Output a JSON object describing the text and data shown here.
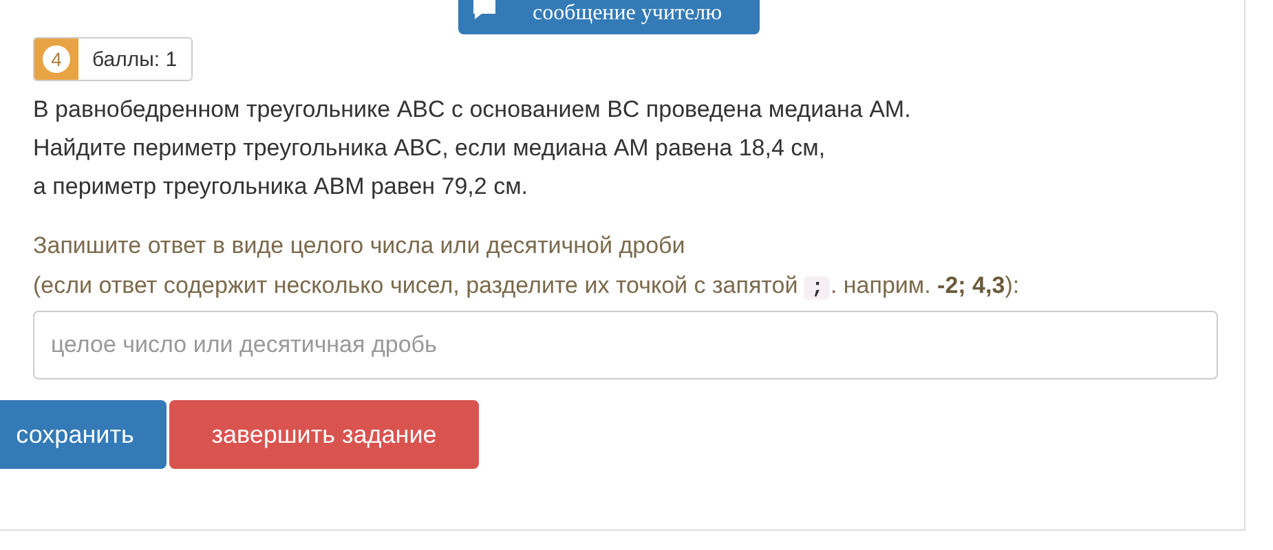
{
  "message_button": {
    "label": "сообщение учителю"
  },
  "task": {
    "number": "4",
    "points": "баллы: 1"
  },
  "question": [
    "В равнобедренном треугольнике ABC с основанием BC проведена медиана AM.",
    "Найдите периметр треугольника ABC, если медиана AM равена 18,4 см,",
    "а периметр треугольника ABM равен 79,2 см."
  ],
  "instruction": "Запишите ответ в виде целого числа или десятичной дроби",
  "hint": {
    "before": "(если ответ содержит несколько чисел, разделите их точкой с запятой",
    "code": ";",
    "after": ". наприм. **-2; 4,3**):"
  },
  "answer": {
    "placeholder": "целое число или десятичная дробь"
  },
  "buttons": [
    {
      "kind": "primary",
      "label": "сохранить"
    },
    {
      "kind": "danger",
      "label": "завершить задание"
    }
  ]
}
